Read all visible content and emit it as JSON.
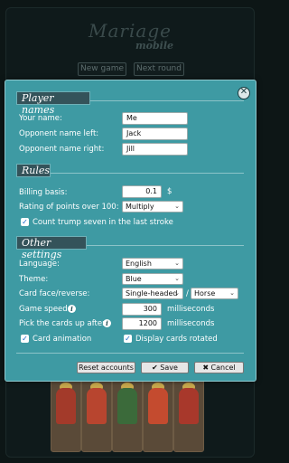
{
  "background": {
    "logo_title": "Mariage",
    "logo_subtitle": "mobile",
    "new_game_label": "New game",
    "next_round_label": "Next round"
  },
  "dialog": {
    "sections": {
      "player_names": "Player names",
      "rules": "Rules",
      "other_settings": "Other settings"
    },
    "player_names": {
      "your_name_label": "Your name:",
      "your_name_value": "Me",
      "left_label": "Opponent name left:",
      "left_value": "Jack",
      "right_label": "Opponent name right:",
      "right_value": "Jill"
    },
    "rules": {
      "billing_label": "Billing basis:",
      "billing_value": "0.1",
      "billing_unit": "$",
      "rating_label": "Rating of points over 100:",
      "rating_value": "Multiply",
      "trump_seven_label": "Count trump seven in the last stroke",
      "trump_seven_checked": true
    },
    "other": {
      "language_label": "Language:",
      "language_value": "English",
      "theme_label": "Theme:",
      "theme_value": "Blue",
      "card_face_label": "Card face/reverse:",
      "card_face_value": "Single-headed",
      "separator": "/",
      "card_reverse_value": "Horse",
      "game_speed_label": "Game speed:",
      "game_speed_value": "300",
      "game_speed_unit": "milliseconds",
      "pick_up_label": "Pick the cards up after:",
      "pick_up_value": "1200",
      "pick_up_unit": "milliseconds",
      "card_animation_label": "Card animation",
      "card_animation_checked": true,
      "display_rotated_label": "Display cards rotated",
      "display_rotated_checked": true
    },
    "buttons": {
      "reset_label": "Reset accounts",
      "save_label": "✔ Save",
      "cancel_label": "✖ Cancel"
    }
  },
  "colors": {
    "dialog_bg": "#3e9aa3",
    "section_header_bg": "#34535a",
    "checkbox_check": "#1463c8"
  }
}
